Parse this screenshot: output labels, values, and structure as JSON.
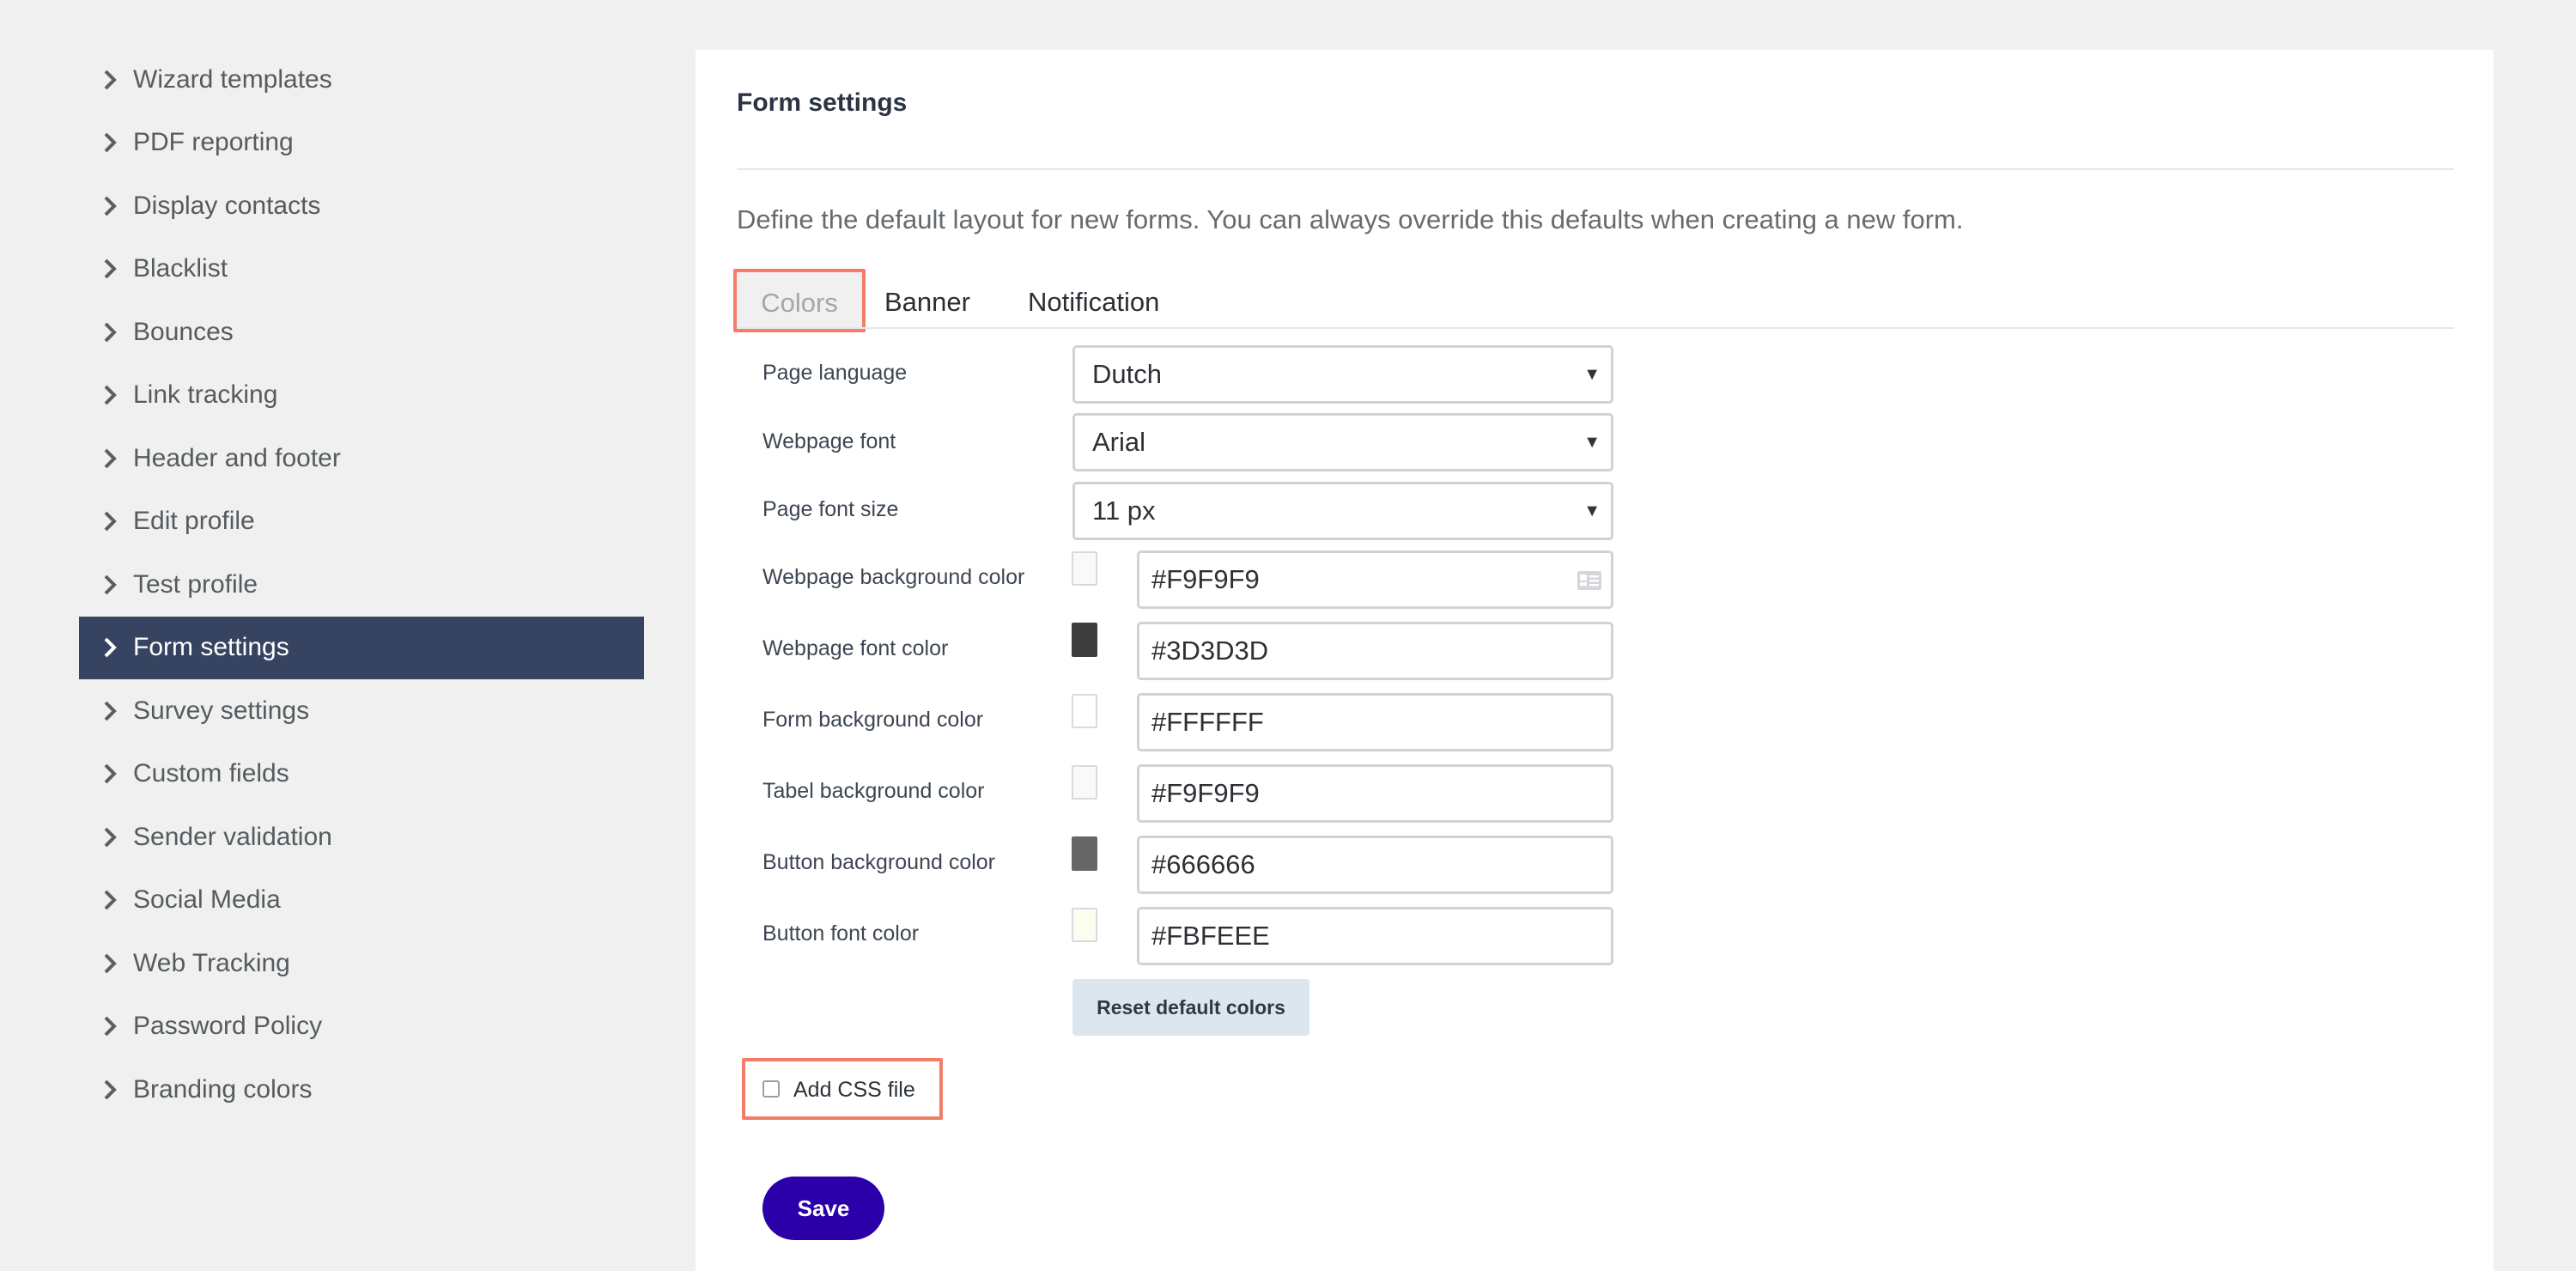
{
  "sidebar": {
    "items": [
      {
        "label": "Wizard templates",
        "active": false
      },
      {
        "label": "PDF reporting",
        "active": false
      },
      {
        "label": "Display contacts",
        "active": false
      },
      {
        "label": "Blacklist",
        "active": false
      },
      {
        "label": "Bounces",
        "active": false
      },
      {
        "label": "Link tracking",
        "active": false
      },
      {
        "label": "Header and footer",
        "active": false
      },
      {
        "label": "Edit profile",
        "active": false
      },
      {
        "label": "Test profile",
        "active": false
      },
      {
        "label": "Form settings",
        "active": true
      },
      {
        "label": "Survey settings",
        "active": false
      },
      {
        "label": "Custom fields",
        "active": false
      },
      {
        "label": "Sender validation",
        "active": false
      },
      {
        "label": "Social Media",
        "active": false
      },
      {
        "label": "Web Tracking",
        "active": false
      },
      {
        "label": "Password Policy",
        "active": false
      },
      {
        "label": "Branding colors",
        "active": false
      }
    ]
  },
  "main": {
    "title": "Form settings",
    "intro": "Define the default layout for new forms. You can always override this defaults when creating a new form.",
    "tabs": [
      {
        "label": "Colors",
        "active": true
      },
      {
        "label": "Banner",
        "active": false
      },
      {
        "label": "Notification",
        "active": false
      }
    ],
    "selects": [
      {
        "label": "Page language",
        "value": "Dutch"
      },
      {
        "label": "Webpage font",
        "value": "Arial"
      },
      {
        "label": "Page font size",
        "value": "11 px"
      }
    ],
    "colors": [
      {
        "label": "Webpage background color",
        "value": "#F9F9F9",
        "swatch": "#F9F9F9"
      },
      {
        "label": "Webpage font color",
        "value": "#3D3D3D",
        "swatch": "#3D3D3D"
      },
      {
        "label": "Form background color",
        "value": "#FFFFFF",
        "swatch": "#FFFFFF"
      },
      {
        "label": "Tabel background color",
        "value": "#F9F9F9",
        "swatch": "#F9F9F9"
      },
      {
        "label": "Button background color",
        "value": "#666666",
        "swatch": "#666666"
      },
      {
        "label": "Button font color",
        "value": "#FBFEEE",
        "swatch": "#FBFEEE"
      }
    ],
    "reset_label": "Reset default colors",
    "add_css_label": "Add CSS file",
    "add_css_checked": false,
    "save_label": "Save"
  },
  "theme": {
    "accent": "#2b00a8",
    "sidebar_active_bg": "#374461",
    "highlight_border": "#f27d69"
  },
  "icons": {
    "nav_chevron": "chevron-right-icon",
    "select_caret": "caret-down-icon",
    "picker": "contact-card-icon"
  }
}
